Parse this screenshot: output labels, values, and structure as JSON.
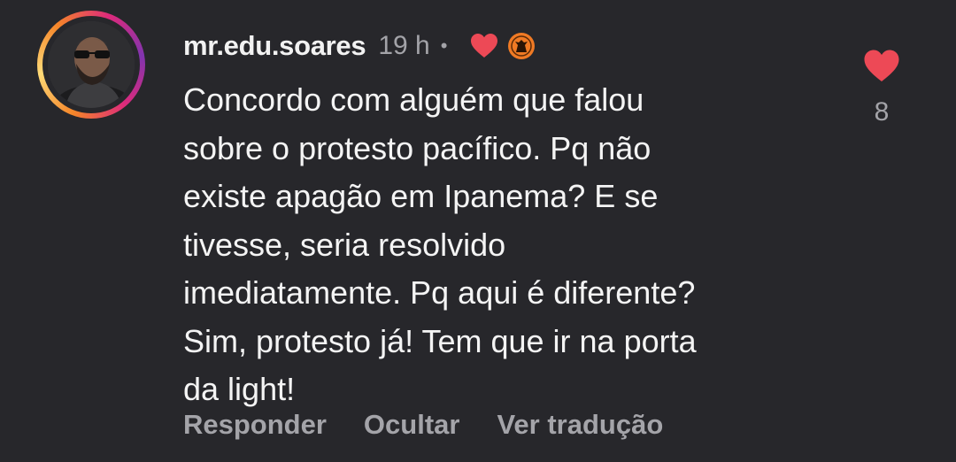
{
  "comment": {
    "username": "mr.edu.soares",
    "time": "19 h",
    "separator": "•",
    "text": "Concordo com alguém que falou\nsobre o protesto pacífico. Pq não\nexiste apagão em Ipanema? E se\ntivesse, seria resolvido\nimediatamente. Pq aqui é diferente?\nSim, protesto já! Tem que ir na porta\nda light!",
    "like_count": "8",
    "icons": {
      "creator_like": "heart-icon",
      "badge": "fan-badge-icon",
      "like": "heart-icon"
    },
    "colors": {
      "heart": "#ed4956",
      "badge": "#f07a24",
      "story_ring_start": "#f58529",
      "story_ring_end": "#8134af"
    }
  },
  "actions": {
    "reply": "Responder",
    "hide": "Ocultar",
    "translate": "Ver tradução"
  }
}
